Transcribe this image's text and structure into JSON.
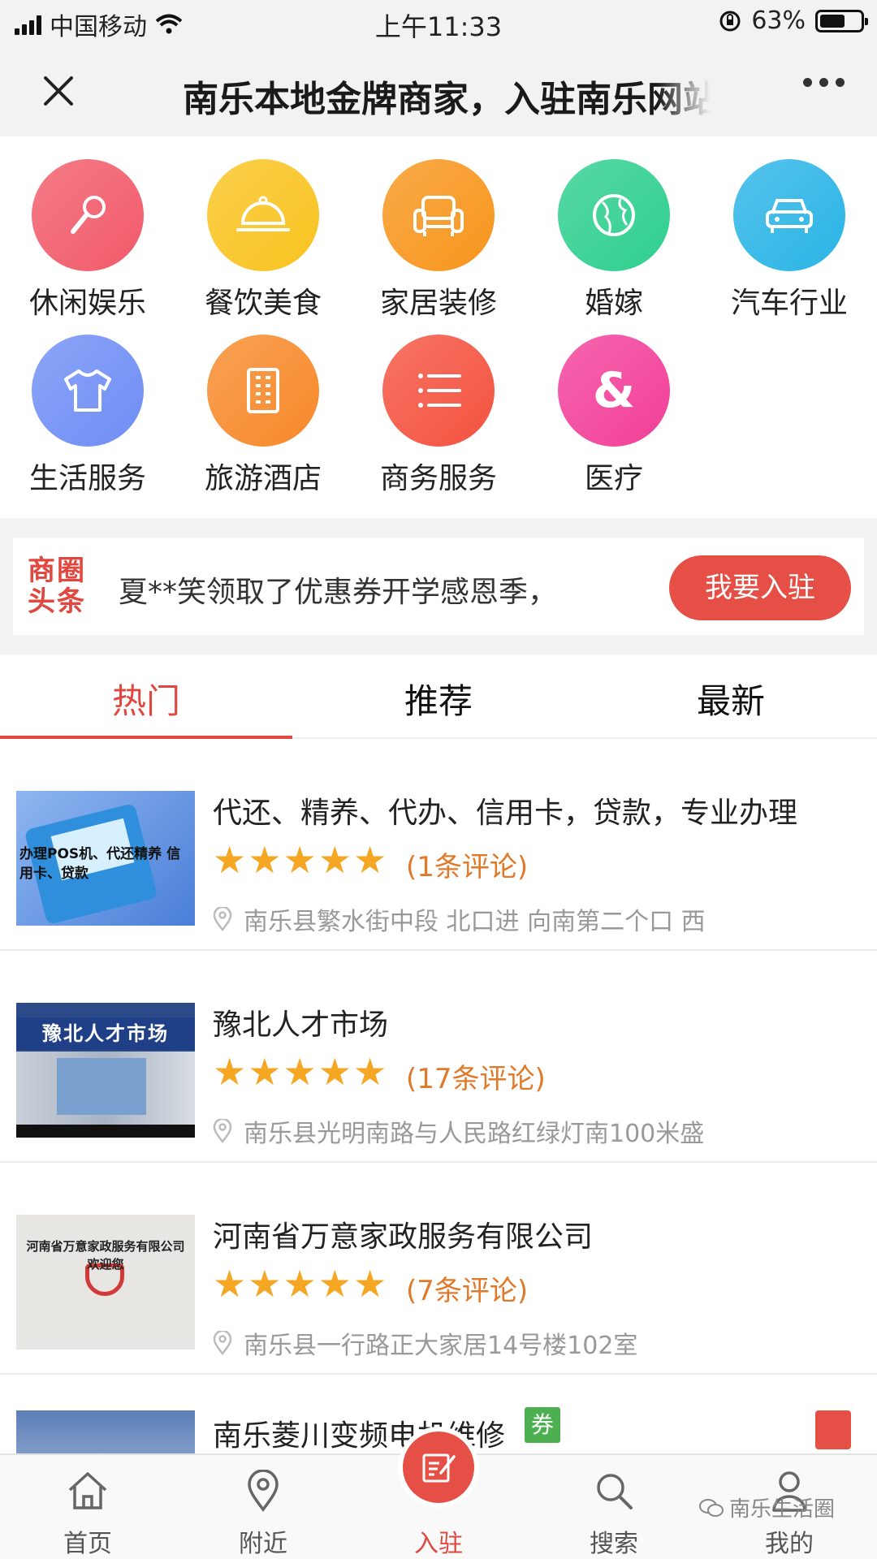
{
  "status_bar": {
    "carrier": "中国移动",
    "time": "上午11:33",
    "battery": "63%",
    "battery_level": 0.63
  },
  "nav": {
    "title": "南乐本地金牌商家，入驻南乐网站"
  },
  "categories": [
    {
      "label": "休闲娱乐",
      "icon": "microphone-icon",
      "color": "#f25a6a"
    },
    {
      "label": "餐饮美食",
      "icon": "food-cloche-icon",
      "color": "#f9c31f"
    },
    {
      "label": "家居装修",
      "icon": "sofa-icon",
      "color": "#f7951c"
    },
    {
      "label": "婚嫁",
      "icon": "globe-icon",
      "color": "#2ecf8e"
    },
    {
      "label": "汽车行业",
      "icon": "car-icon",
      "color": "#2ab4e6"
    },
    {
      "label": "生活服务",
      "icon": "tshirt-icon",
      "color": "#6f8ef5"
    },
    {
      "label": "旅游酒店",
      "icon": "building-icon",
      "color": "#f7892a"
    },
    {
      "label": "商务服务",
      "icon": "list-icon",
      "color": "#f4523f"
    },
    {
      "label": "医疗",
      "icon": "ampersand-icon",
      "color": "#f23f99"
    }
  ],
  "headline": {
    "logo": "商圈头条",
    "text": "夏**笑领取了优惠券开学感恩季，",
    "button": "我要入驻"
  },
  "tabs": [
    "热门",
    "推荐",
    "最新"
  ],
  "active_tab": 0,
  "listings": [
    {
      "title": "代还、精养、代办、信用卡，贷款，专业办理",
      "reviews": "(1条评论)",
      "rating": 5,
      "address": "南乐县繁水街中段 北口进 向南第二个口 西",
      "thumb_text": "办理POS机、代还精养 信用卡、贷款"
    },
    {
      "title": "豫北人才市场",
      "reviews": "(17条评论)",
      "rating": 5,
      "address": "南乐县光明南路与人民路红绿灯南100米盛",
      "thumb_text": "豫北人才市场"
    },
    {
      "title": "河南省万意家政服务有限公司",
      "reviews": "(7条评论)",
      "rating": 5,
      "address": "南乐县一行路正大家居14号楼102室",
      "thumb_text": "河南省万意家政服务有限公司 欢迎您"
    },
    {
      "title": "南乐菱川变频电机维修",
      "badge": "券"
    }
  ],
  "bottom_tabs": [
    {
      "label": "首页",
      "icon": "home-icon"
    },
    {
      "label": "附近",
      "icon": "location-icon"
    },
    {
      "label": "入驻",
      "icon": "edit-icon"
    },
    {
      "label": "搜索",
      "icon": "search-icon"
    },
    {
      "label": "我的",
      "icon": "user-icon"
    }
  ],
  "watermark": "南乐生活圈"
}
